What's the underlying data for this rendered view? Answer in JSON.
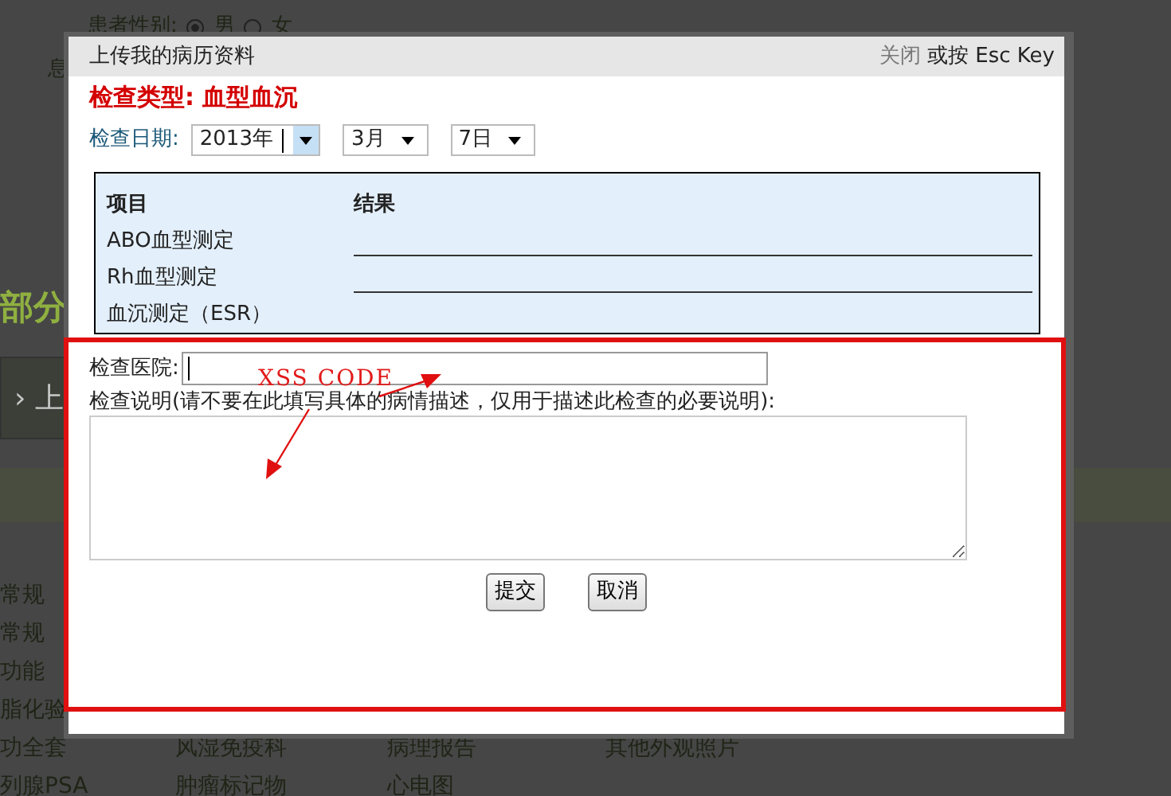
{
  "background_page": {
    "gender_label": "患者性别:",
    "gender_options": [
      {
        "label": "男",
        "selected": true
      },
      {
        "label": "女",
        "selected": false
      }
    ],
    "side_label": "息",
    "section_heading": "部分",
    "tab_arrow": "›",
    "tab_label": "上",
    "category_rows": [
      [
        "常规"
      ],
      [
        "常规"
      ],
      [
        "功能"
      ],
      [
        "脂化验"
      ],
      [
        "功全套",
        "风湿免疫科",
        "病理报告",
        "其他外观照片"
      ],
      [
        "列腺PSA",
        "肿瘤标记物",
        "心电图"
      ]
    ]
  },
  "dialog": {
    "title": "上传我的病历资料",
    "close_link": "关闭",
    "close_hint": "或按 Esc Key",
    "exam_type": "检查类型: 血型血沉",
    "date_label": "检查日期:",
    "date_selects": [
      {
        "value": "2013年",
        "focused": true
      },
      {
        "value": "3月",
        "focused": false
      },
      {
        "value": "7日",
        "focused": false
      }
    ],
    "results_table": {
      "columns": [
        "项目",
        "结果"
      ],
      "rows": [
        {
          "item": "ABO血型测定",
          "result_line": true
        },
        {
          "item": "Rh血型测定",
          "result_line": true
        },
        {
          "item": "血沉测定（ESR）",
          "result_line": false
        }
      ]
    },
    "hospital_label": "检查医院:",
    "hospital_field": {
      "focused": true
    },
    "notes_label": "检查说明(请不要在此填写具体的病情描述，仅用于描述此检查的必要说明):",
    "buttons": [
      "提交",
      "取消"
    ]
  },
  "annotation": {
    "text": "XSS CODE"
  }
}
